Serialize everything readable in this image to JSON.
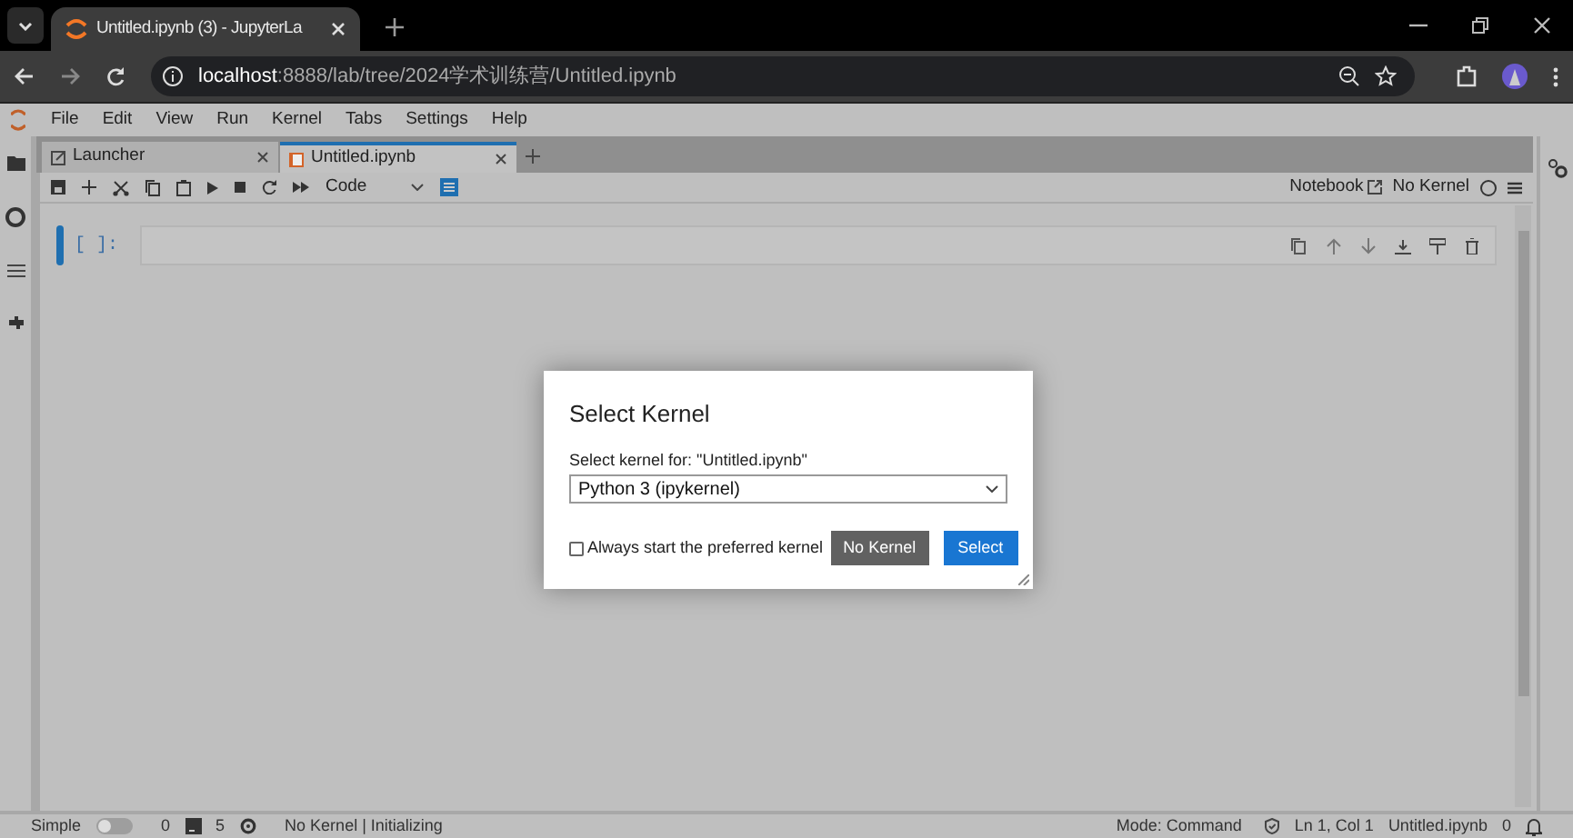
{
  "browser": {
    "tab_title": "Untitled.ipynb (3) - JupyterLa",
    "url_host": "localhost",
    "url_path": ":8888/lab/tree/2024学术训练营/Untitled.ipynb"
  },
  "menu": [
    "File",
    "Edit",
    "View",
    "Run",
    "Kernel",
    "Tabs",
    "Settings",
    "Help"
  ],
  "doc_tabs": [
    {
      "label": "Launcher",
      "kind": "launcher",
      "selected": false
    },
    {
      "label": "Untitled.ipynb",
      "kind": "notebook",
      "selected": true
    }
  ],
  "toolbar": {
    "cell_type": "Code",
    "notebook_label": "Notebook",
    "kernel_name": "No Kernel"
  },
  "cell": {
    "prompt": "[ ]:"
  },
  "dialog": {
    "title": "Select Kernel",
    "label": "Select kernel for: \"Untitled.ipynb\"",
    "kernel_option": "Python 3 (ipykernel)",
    "checkbox": {
      "label": "Always start the preferred kernel",
      "checked": false
    },
    "buttons": [
      {
        "label": "No Kernel",
        "kind": "secondary"
      },
      {
        "label": "Select",
        "kind": "primary"
      }
    ]
  },
  "status_bar": {
    "simple_label": "Simple",
    "simple_on": false,
    "terminals": "0",
    "kernels": "5",
    "kernel_status": "No Kernel | Initializing",
    "mode": "Mode: Command",
    "position": "Ln 1, Col 1",
    "file": "Untitled.ipynb",
    "notifications": "0"
  }
}
